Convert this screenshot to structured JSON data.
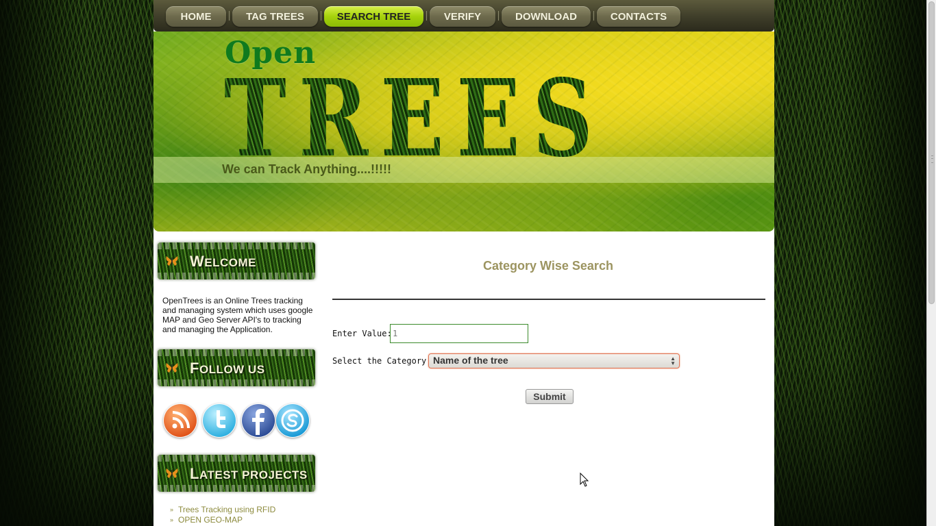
{
  "nav": {
    "items": [
      {
        "label": "HOME",
        "active": false
      },
      {
        "label": "TAG TREES",
        "active": false
      },
      {
        "label": "SEARCH TREE",
        "active": true
      },
      {
        "label": "VERIFY",
        "active": false
      },
      {
        "label": "DOWNLOAD",
        "active": false
      },
      {
        "label": "CONTACTS",
        "active": false
      }
    ]
  },
  "banner": {
    "logo_small": "Open",
    "logo_large": "TREES",
    "tagline": "We can Track Anything....!!!!!"
  },
  "sidebar": {
    "welcome": {
      "title_first": "W",
      "title_rest": "ELCOME",
      "text": "OpenTrees is an Online Trees tracking and managing system which uses google MAP and Geo Server API's to tracking and managing the Application."
    },
    "follow": {
      "title_first": "F",
      "title_rest": "OLLOW US",
      "icons": [
        "rss-icon",
        "twitter-icon",
        "facebook-icon",
        "skype-icon"
      ]
    },
    "projects": {
      "title_first": "L",
      "title_rest": "ATEST PROJECTS",
      "items": [
        "Trees Tracking using RFID",
        "OPEN GEO-MAP"
      ]
    }
  },
  "search": {
    "title": "Category Wise Search",
    "value_label": "Enter Value:",
    "value": "1",
    "category_label": "Select the Category:",
    "category_selected": "Name of the tree",
    "submit_label": "Submit"
  },
  "colors": {
    "nav_active": "#a6d20c",
    "section_title": "#9c9460",
    "link": "#8c8a3c"
  }
}
